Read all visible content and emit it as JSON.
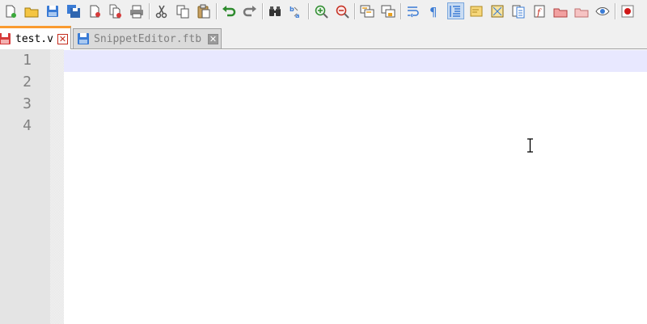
{
  "toolbar": {
    "buttons": [
      {
        "name": "new-file-icon"
      },
      {
        "name": "open-file-icon"
      },
      {
        "name": "save-icon"
      },
      {
        "name": "save-all-icon"
      },
      {
        "name": "close-icon"
      },
      {
        "name": "close-all-icon"
      },
      {
        "name": "print-icon"
      },
      {
        "sep": true
      },
      {
        "name": "cut-icon"
      },
      {
        "name": "copy-icon"
      },
      {
        "name": "paste-icon"
      },
      {
        "sep": true
      },
      {
        "name": "undo-icon"
      },
      {
        "name": "redo-icon"
      },
      {
        "sep": true
      },
      {
        "name": "find-icon"
      },
      {
        "name": "replace-icon"
      },
      {
        "sep": true
      },
      {
        "name": "zoom-in-icon"
      },
      {
        "name": "zoom-out-icon"
      },
      {
        "sep": true
      },
      {
        "name": "sync-vertical-icon"
      },
      {
        "name": "sync-horizontal-icon"
      },
      {
        "sep": true
      },
      {
        "name": "word-wrap-icon"
      },
      {
        "name": "show-all-characters-icon"
      },
      {
        "name": "indent-guide-icon",
        "active": true
      },
      {
        "name": "user-language-icon"
      },
      {
        "name": "document-map-icon"
      },
      {
        "name": "function-list-icon"
      },
      {
        "name": "folder-as-workspace-icon"
      },
      {
        "name": "monitoring-icon"
      },
      {
        "name": "project-folder-icon"
      },
      {
        "name": "eye-icon"
      },
      {
        "sep": true
      },
      {
        "name": "macro-record-icon"
      }
    ]
  },
  "tabs": [
    {
      "label": "test.v",
      "active": true,
      "close": "✕"
    },
    {
      "label": "SnippetEditor.ftb",
      "active": false,
      "close": "✕"
    }
  ],
  "editor": {
    "line_numbers": [
      "1",
      "2",
      "3",
      "4"
    ],
    "current_line": 1
  },
  "colors": {
    "active_tab_accent": "#fa9b30",
    "current_line": "#e8e8ff",
    "gutter": "#e4e4e4",
    "line_number_text": "#808080"
  }
}
